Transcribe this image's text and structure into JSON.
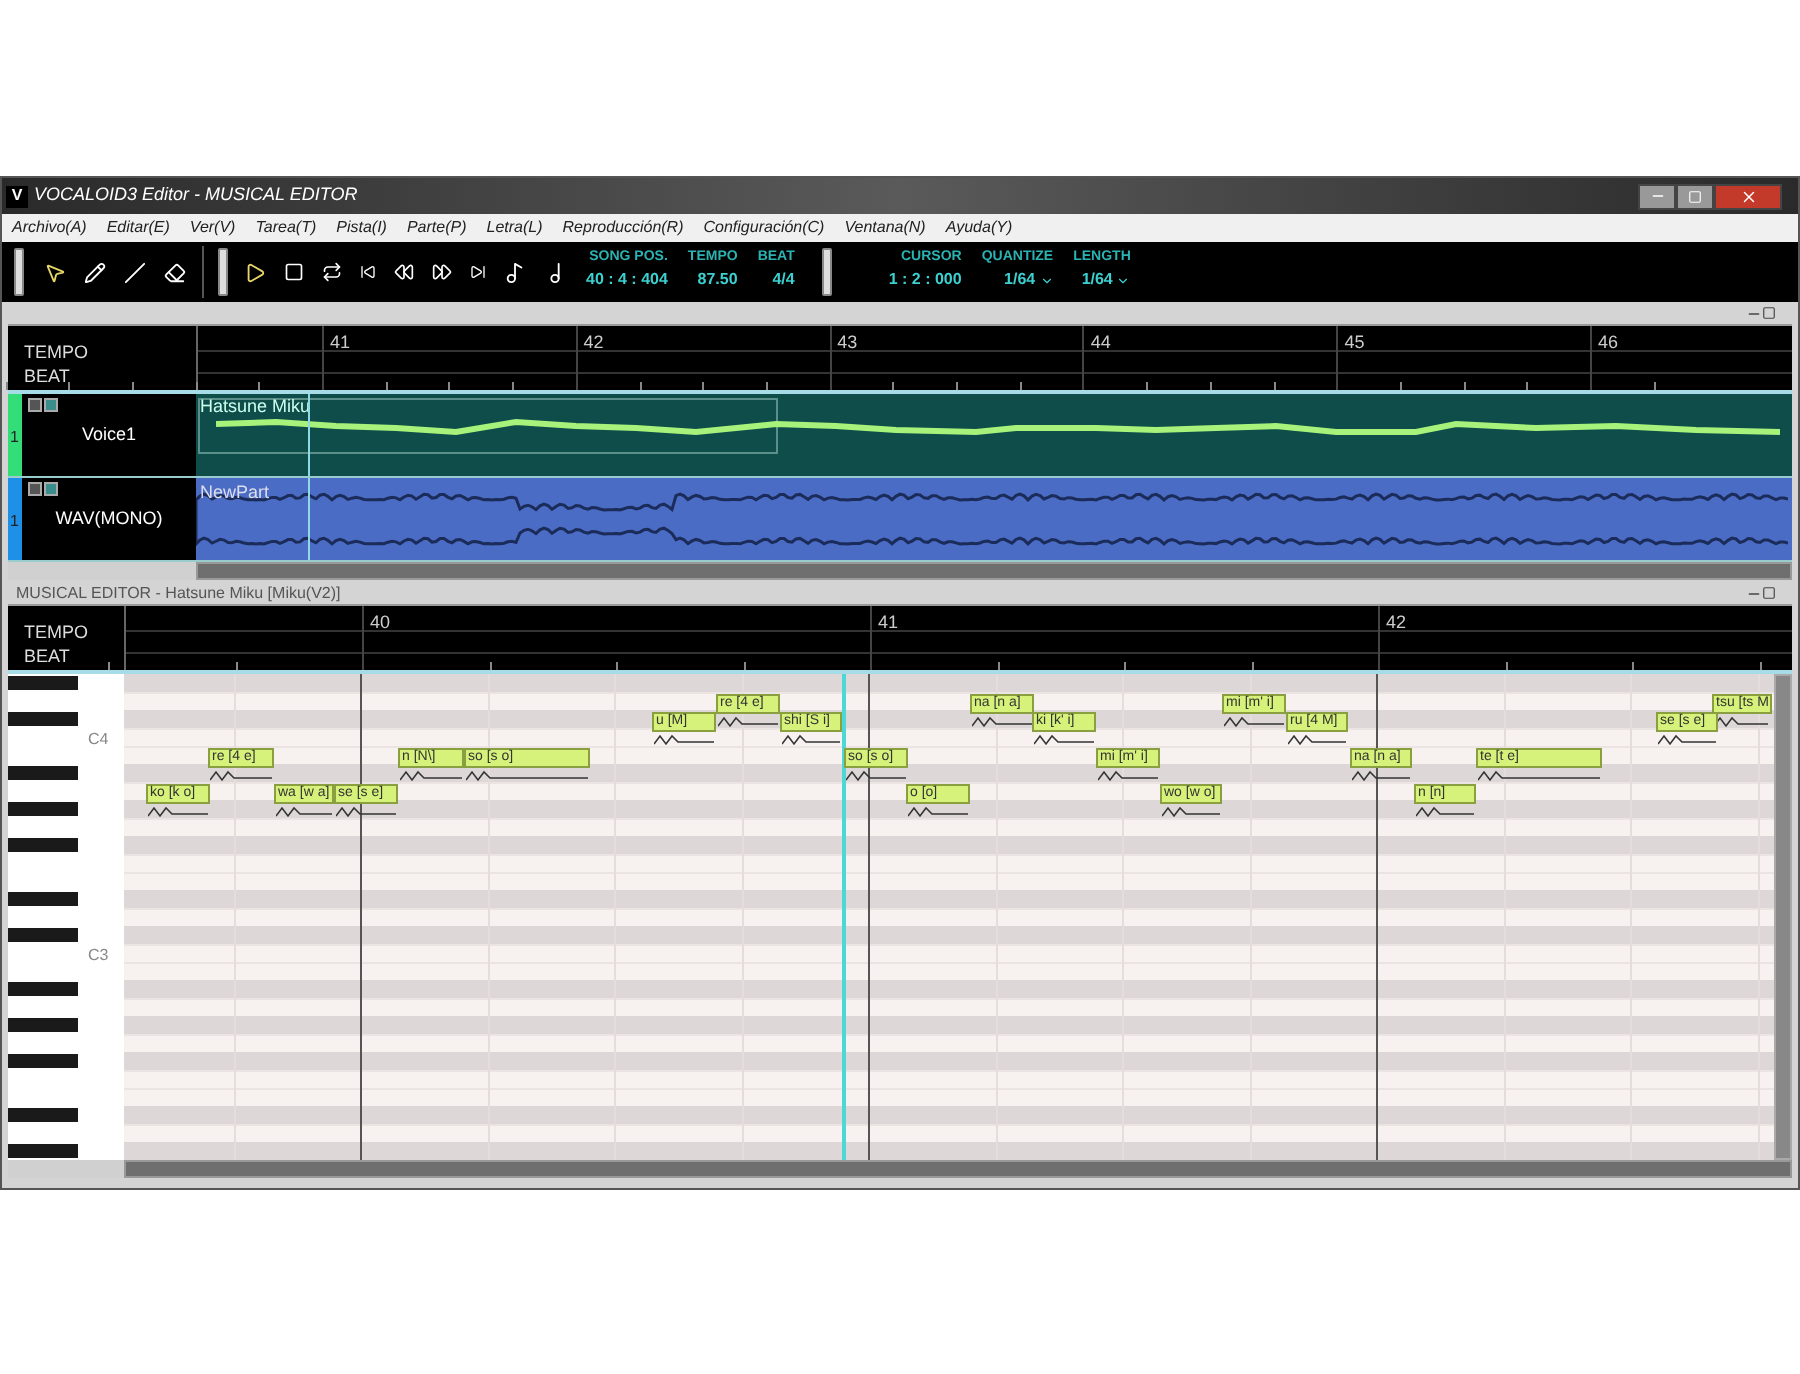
{
  "window": {
    "icon": "V",
    "title": "VOCALOID3 Editor - MUSICAL EDITOR"
  },
  "menu": [
    "Archivo(A)",
    "Editar(E)",
    "Ver(V)",
    "Tarea(T)",
    "Pista(I)",
    "Parte(P)",
    "Letra(L)",
    "Reproducción(R)",
    "Configuración(C)",
    "Ventana(N)",
    "Ayuda(Y)"
  ],
  "tools": [
    {
      "kind": "arrow",
      "selected": true
    },
    {
      "kind": "pencil",
      "selected": false
    },
    {
      "kind": "line",
      "selected": false
    },
    {
      "kind": "eraser",
      "selected": false
    }
  ],
  "readouts": [
    {
      "label": "SONG POS.",
      "value": "40 : 4 : 404",
      "kind": "text"
    },
    {
      "label": "TEMPO",
      "value": "87.50",
      "kind": "text"
    },
    {
      "label": "BEAT",
      "value": "4/4",
      "kind": "text"
    },
    {
      "label": "CURSOR",
      "value": "1 : 2 : 000",
      "kind": "text"
    },
    {
      "label": "QUANTIZE",
      "value": "1/64",
      "kind": "dropdown"
    },
    {
      "label": "LENGTH",
      "value": "1/64",
      "kind": "dropdown"
    }
  ],
  "track_editor": {
    "ruler": {
      "measures": [
        "41",
        "42",
        "43",
        "44",
        "45",
        "46"
      ],
      "rows": [
        "TEMPO",
        "BEAT"
      ]
    },
    "tracks": [
      {
        "number": "1",
        "name": "Voice1",
        "part": "Hatsune Miku",
        "color": "#33dd77",
        "kind": "voice"
      },
      {
        "number": "1",
        "name": "WAV(MONO)",
        "part": "NewPart",
        "color": "#1e90e8",
        "kind": "audio"
      }
    ]
  },
  "musical_editor": {
    "title": "MUSICAL EDITOR - Hatsune Miku [Miku(V2)]",
    "ruler": {
      "measures": [
        "40",
        "41",
        "42"
      ],
      "rows": [
        "TEMPO",
        "BEAT"
      ]
    },
    "keys": [
      "C4",
      "C3"
    ],
    "notes": [
      {
        "lyric": "ko [k o]"
      },
      {
        "lyric": "re [4 e]"
      },
      {
        "lyric": "wa [w a]"
      },
      {
        "lyric": "se [s e]"
      },
      {
        "lyric": "n [N\\]"
      },
      {
        "lyric": "so [s o]"
      },
      {
        "lyric": "u [M]"
      },
      {
        "lyric": "re [4 e]"
      },
      {
        "lyric": "shi [S i]"
      },
      {
        "lyric": "so [s o]"
      },
      {
        "lyric": "o [o]"
      },
      {
        "lyric": "na [n a]"
      },
      {
        "lyric": "ki [k' i]"
      },
      {
        "lyric": "mi [m' i]"
      },
      {
        "lyric": "wo [w o]"
      },
      {
        "lyric": "mi [m' i]"
      },
      {
        "lyric": "ru [4 M]"
      },
      {
        "lyric": "na [n a]"
      },
      {
        "lyric": "n [n]"
      },
      {
        "lyric": "te [t e]"
      },
      {
        "lyric": "se [s e]"
      },
      {
        "lyric": "tsu [ts M"
      }
    ]
  }
}
